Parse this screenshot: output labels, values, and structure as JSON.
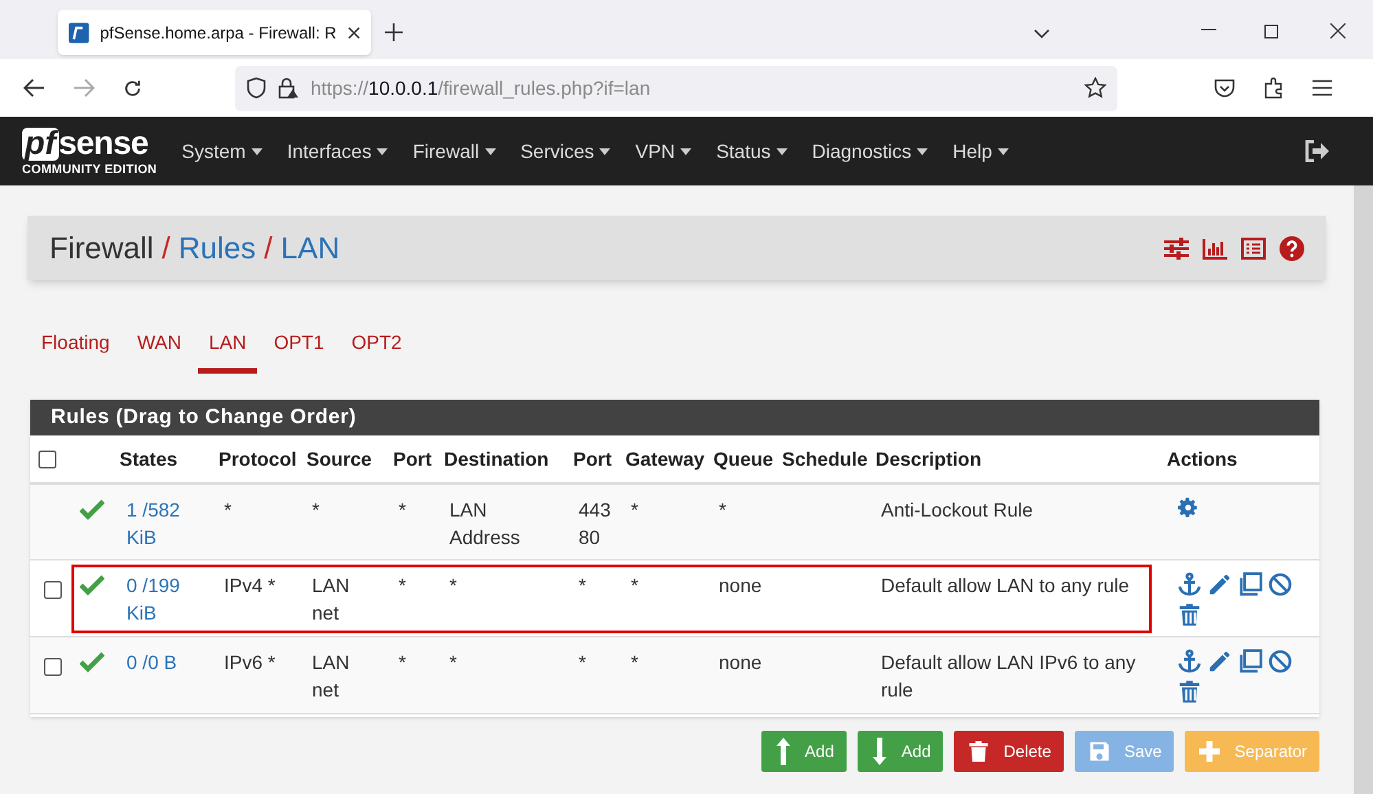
{
  "browser": {
    "tab_title": "pfSense.home.arpa - Firewall: R",
    "url_scheme": "https://",
    "url_host": "10.0.0.1",
    "url_path": "/firewall_rules.php?if=lan"
  },
  "navbar": {
    "logo_pf": "pf",
    "logo_sense": "sense",
    "logo_edition": "COMMUNITY EDITION",
    "menus": [
      {
        "label": "System"
      },
      {
        "label": "Interfaces"
      },
      {
        "label": "Firewall"
      },
      {
        "label": "Services"
      },
      {
        "label": "VPN"
      },
      {
        "label": "Status"
      },
      {
        "label": "Diagnostics"
      },
      {
        "label": "Help"
      }
    ]
  },
  "breadcrumb": {
    "separator": "/",
    "items": [
      "Firewall",
      "Rules",
      "LAN"
    ]
  },
  "tabs": [
    {
      "label": "Floating",
      "selected": false
    },
    {
      "label": "WAN",
      "selected": false
    },
    {
      "label": "LAN",
      "selected": true
    },
    {
      "label": "OPT1",
      "selected": false
    },
    {
      "label": "OPT2",
      "selected": false
    }
  ],
  "panel": {
    "title": "Rules (Drag to Change Order)",
    "select_all_checked": false,
    "columns": [
      "States",
      "Protocol",
      "Source",
      "Port",
      "Destination",
      "Port",
      "Gateway",
      "Queue",
      "Schedule",
      "Description",
      "Actions"
    ],
    "rows": [
      {
        "has_checkbox": false,
        "highlighted": false,
        "cells": [
          "1 /582 KiB",
          "*",
          "*",
          "*",
          "LAN Address",
          "443 80",
          "*",
          "*",
          "",
          "Anti-Lockout Rule"
        ],
        "actions": [
          {
            "kind": "settings"
          }
        ]
      },
      {
        "has_checkbox": true,
        "checked": false,
        "highlighted": true,
        "cells": [
          "0 /199 KiB",
          "IPv4 *",
          "LAN net",
          "*",
          "*",
          "*",
          "*",
          "none",
          "",
          "Default allow LAN to any rule"
        ],
        "actions": [
          {
            "kind": "anchor"
          },
          {
            "kind": "edit"
          },
          {
            "kind": "copy"
          },
          {
            "kind": "disable"
          },
          {
            "kind": "delete"
          }
        ]
      },
      {
        "has_checkbox": true,
        "checked": false,
        "highlighted": false,
        "cells": [
          "0 /0 B",
          "IPv6 *",
          "LAN net",
          "*",
          "*",
          "*",
          "*",
          "none",
          "",
          "Default allow LAN IPv6 to any rule"
        ],
        "actions": [
          {
            "kind": "anchor"
          },
          {
            "kind": "edit"
          },
          {
            "kind": "copy"
          },
          {
            "kind": "disable"
          },
          {
            "kind": "delete"
          }
        ]
      }
    ]
  },
  "buttons": [
    {
      "label": "Add",
      "kind": "add_top",
      "color": "#43a047"
    },
    {
      "label": "Add",
      "kind": "add_bottom",
      "color": "#43a047"
    },
    {
      "label": "Delete",
      "kind": "delete",
      "color": "#c62828"
    },
    {
      "label": "Save",
      "kind": "save",
      "color": "#85b4e4"
    },
    {
      "label": "Separator",
      "kind": "separator",
      "color": "#f7b954"
    }
  ]
}
